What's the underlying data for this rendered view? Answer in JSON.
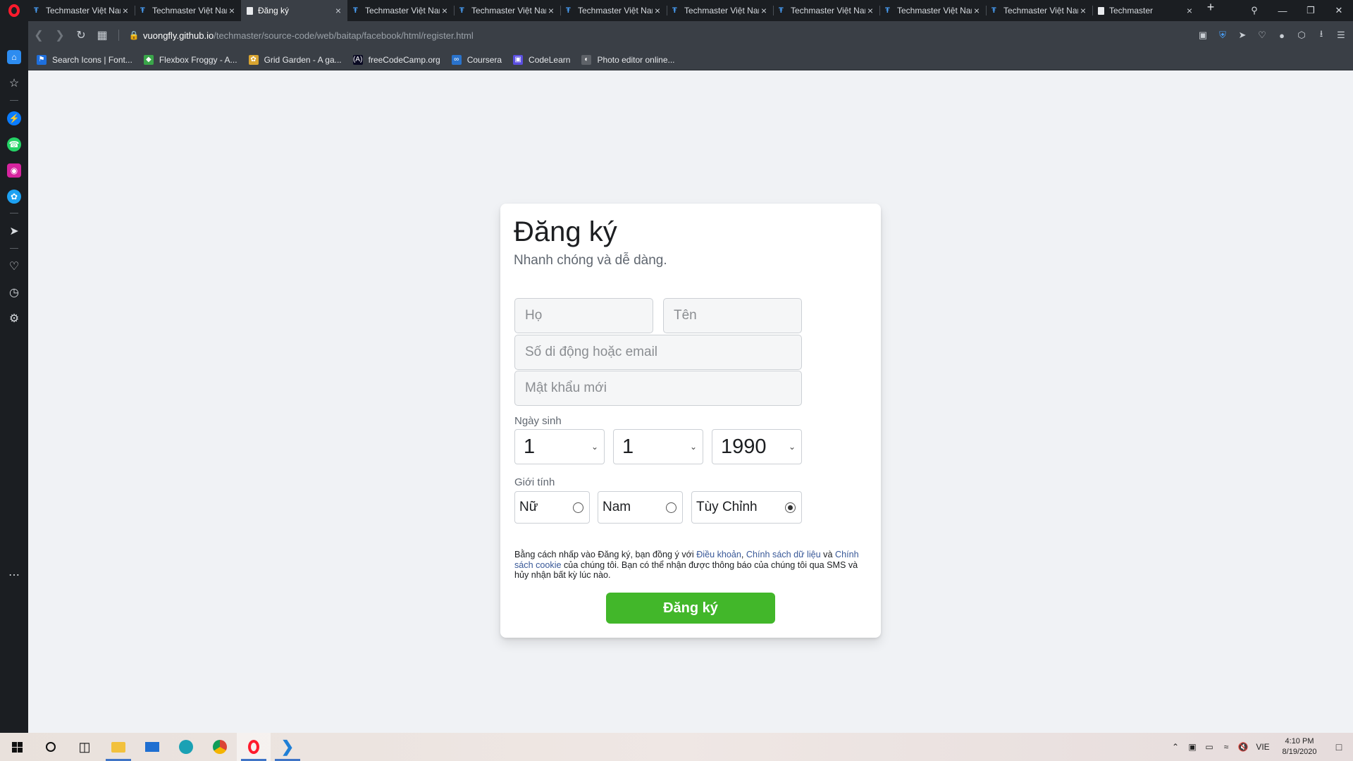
{
  "browser": {
    "tabs": [
      {
        "title": "Techmaster Việt Nam",
        "active": false,
        "icon": "techmaster-favicon"
      },
      {
        "title": "Techmaster Việt Nam",
        "active": false,
        "icon": "techmaster-favicon"
      },
      {
        "title": "Đăng ký",
        "active": true,
        "icon": "document-favicon"
      },
      {
        "title": "Techmaster Việt Nam",
        "active": false,
        "icon": "techmaster-favicon"
      },
      {
        "title": "Techmaster Việt Nam",
        "active": false,
        "icon": "techmaster-favicon"
      },
      {
        "title": "Techmaster Việt Nam",
        "active": false,
        "icon": "techmaster-favicon"
      },
      {
        "title": "Techmaster Việt Nam",
        "active": false,
        "icon": "techmaster-favicon"
      },
      {
        "title": "Techmaster Việt Nam",
        "active": false,
        "icon": "techmaster-favicon"
      },
      {
        "title": "Techmaster Việt Nam",
        "active": false,
        "icon": "techmaster-favicon"
      },
      {
        "title": "Techmaster Việt Nam",
        "active": false,
        "icon": "techmaster-favicon"
      },
      {
        "title": "Techmaster",
        "active": false,
        "icon": "document-favicon"
      }
    ],
    "url_host": "vuongfly.github.io",
    "url_path": "/techmaster/source-code/web/baitap/facebook/html/register.html",
    "bookmarks": [
      {
        "label": "Search Icons | Font...",
        "color": "#1e6fdc",
        "glyph": "⚑"
      },
      {
        "label": "Flexbox Froggy - A...",
        "color": "#3aa64a",
        "glyph": "◆"
      },
      {
        "label": "Grid Garden - A ga...",
        "color": "#d8a431",
        "glyph": "✿"
      },
      {
        "label": "freeCodeCamp.org",
        "color": "#0a0a23",
        "glyph": "(A)"
      },
      {
        "label": "Coursera",
        "color": "#2a73cc",
        "glyph": "∞"
      },
      {
        "label": "CodeLearn",
        "color": "#5b4fe0",
        "glyph": "▣"
      },
      {
        "label": "Photo editor online...",
        "color": "#5e6268",
        "glyph": "◐"
      }
    ]
  },
  "form": {
    "title": "Đăng ký",
    "subtitle": "Nhanh chóng và dễ dàng.",
    "last_name_placeholder": "Họ",
    "first_name_placeholder": "Tên",
    "contact_placeholder": "Số di động hoặc email",
    "password_placeholder": "Mật khẩu mới",
    "birthday_label": "Ngày sinh",
    "birthday": {
      "day": "1",
      "month": "1",
      "year": "1990"
    },
    "gender_label": "Giới tính",
    "genders": [
      {
        "label": "Nữ",
        "checked": false
      },
      {
        "label": "Nam",
        "checked": false
      },
      {
        "label": "Tùy Chỉnh",
        "checked": true
      }
    ],
    "terms": {
      "part1": "Bằng cách nhấp vào Đăng ký, bạn đồng ý với ",
      "link_terms": "Điều khoản",
      "sep1": ", ",
      "link_data": "Chính sách dữ liệu",
      "part2": " và ",
      "link_cookie": "Chính sách cookie",
      "part3": " của chúng tôi. Bạn có thể nhận được thông báo của chúng tôi qua SMS và hủy nhận bất kỳ lúc nào."
    },
    "submit_label": "Đăng ký",
    "submit_color": "#42b72a"
  },
  "taskbar": {
    "language": "VIE",
    "time": "4:10 PM",
    "date": "8/19/2020"
  }
}
